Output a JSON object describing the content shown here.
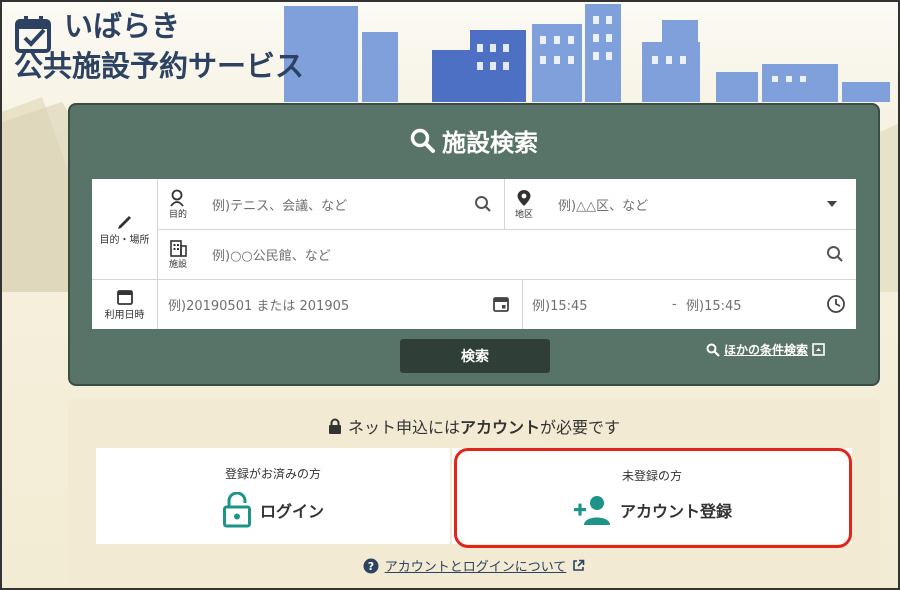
{
  "brand": {
    "line1": "いばらき",
    "line2": "公共施設予約サービス",
    "logo_icon": "calendar-check-icon",
    "color": "#2d4262"
  },
  "search_panel": {
    "title": "施設検索",
    "bg_color": "#587367",
    "purpose_label": "目的・場所",
    "purpose_field_label": "目的",
    "purpose_placeholder": "例)テニス、会議、など",
    "area_label": "地区",
    "area_placeholder": "例)△△区、など",
    "facility_label": "施設",
    "facility_placeholder": "例)○○公民館、など",
    "date_label": "利用日時",
    "date_placeholder": "例)20190501 または 201905",
    "time_from_placeholder": "例)15:45",
    "time_separator": "-",
    "time_to_placeholder": "例)15:45",
    "search_button": "検索",
    "other_search_link": "ほかの条件検索"
  },
  "account_panel": {
    "message_pre": "ネット申込には",
    "message_bold": "アカウント",
    "message_post": "が必要です",
    "registered_sub": "登録がお済みの方",
    "login_label": "ログイン",
    "unregistered_sub": "未登録の方",
    "register_label": "アカウント登録",
    "help_link": "アカウントとログインについて",
    "accent_color": "#1e9488",
    "highlight_color": "#e1251b"
  }
}
